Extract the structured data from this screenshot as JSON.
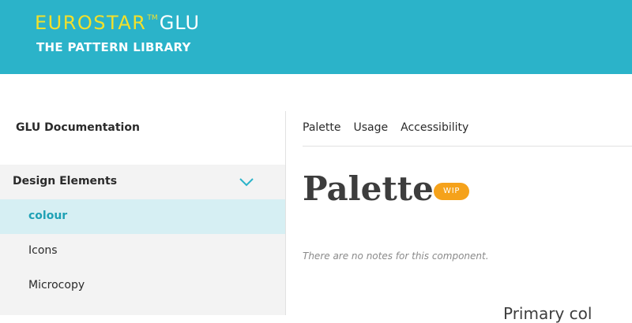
{
  "header": {
    "brand_main": "EUROSTAR",
    "brand_tm": "TM",
    "brand_sub": "GLU",
    "tagline": "THE PATTERN LIBRARY",
    "background_color": "#2bb3c9",
    "brand_color": "#f2e02b"
  },
  "sidebar": {
    "doc_link": "GLU Documentation",
    "section": {
      "title": "Design Elements",
      "icon": "chevron-down-icon",
      "expanded": true
    },
    "items": [
      {
        "label": "colour",
        "active": true
      },
      {
        "label": "Icons",
        "active": false
      },
      {
        "label": "Microcopy",
        "active": false
      }
    ],
    "active_color": "#1fa1b5",
    "active_bg": "#d6eff3"
  },
  "main": {
    "tabs": [
      {
        "label": "Palette"
      },
      {
        "label": "Usage"
      },
      {
        "label": "Accessibility"
      }
    ],
    "title": "Palette",
    "badge": "WIP",
    "badge_color": "#f5a21b",
    "notes": "There are no notes for this component.",
    "cutoff_heading": "Primary col"
  }
}
